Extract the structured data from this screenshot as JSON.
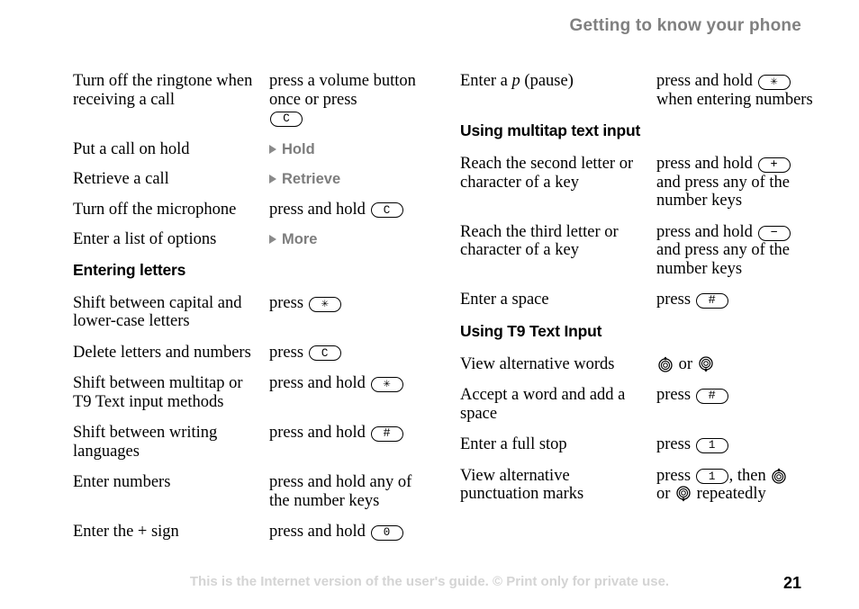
{
  "header": {
    "title": "Getting to know your phone"
  },
  "footer": {
    "note": "This is the Internet version of the user's guide. © Print only for private use.",
    "page_number": "21"
  },
  "keys": {
    "clear": "C",
    "star": "✳",
    "hash": "#",
    "zero": "0",
    "one": "1",
    "plus": "+",
    "minus": "−"
  },
  "left_column": {
    "rows_top": [
      {
        "action": "Turn off the ringtone when receiving a call",
        "method_pre": "press a volume button once or press",
        "key": "C",
        "type": "text-then-key-newline"
      },
      {
        "action": "Put a call on hold",
        "softkey": "Hold",
        "type": "softkey"
      },
      {
        "action": "Retrieve a call",
        "softkey": "Retrieve",
        "type": "softkey"
      },
      {
        "action": "Turn off the microphone",
        "method_pre": "press and hold",
        "key": "C",
        "type": "text-key"
      },
      {
        "action": "Enter a list of options",
        "softkey": "More",
        "type": "softkey"
      }
    ],
    "heading": "Entering letters",
    "rows_bottom": [
      {
        "action": "Shift between capital and lower-case letters",
        "method_pre": "press",
        "key": "✳",
        "type": "text-key"
      },
      {
        "action": "Delete letters and numbers",
        "method_pre": "press",
        "key": "C",
        "type": "text-key"
      },
      {
        "action": "Shift between multitap or T9 Text input methods",
        "method_pre": "press and hold",
        "key": "✳",
        "type": "text-key"
      },
      {
        "action": "Shift between writing languages",
        "method_pre": "press and hold",
        "key": "#",
        "type": "text-key"
      },
      {
        "action": "Enter numbers",
        "method_pre": "press and hold any of the number keys",
        "type": "text-only"
      },
      {
        "action": "Enter the + sign",
        "method_pre": "press and hold",
        "key": "0",
        "type": "text-key"
      }
    ]
  },
  "right_column": {
    "row_pause": {
      "action_pre": "Enter a ",
      "action_italic": "p",
      "action_post": " (pause)",
      "method_pre": "press and hold",
      "key": "✳",
      "method_post": "when entering numbers"
    },
    "heading_multitap": "Using multitap text input",
    "rows_multitap": [
      {
        "action": "Reach the second letter or character of a key",
        "method_pre": "press and hold",
        "key": "+",
        "method_post": "and press any of the number keys"
      },
      {
        "action": "Reach the third letter or character of a key",
        "method_pre": "press and hold",
        "key": "−",
        "method_post": "and press any of the number keys"
      },
      {
        "action": "Enter a space",
        "method_pre": "press",
        "key": "#",
        "method_post": ""
      }
    ],
    "heading_t9": "Using T9 Text Input",
    "rows_t9": [
      {
        "action": "View alternative words",
        "nav_up": "scroll-up-key-icon",
        "joiner": "or",
        "nav_down": "scroll-down-key-icon",
        "type": "navkeys"
      },
      {
        "action": "Accept a word and add a space",
        "method_pre": "press",
        "key": "#",
        "type": "text-key"
      },
      {
        "action": "Enter a full stop",
        "method_pre": "press",
        "key": "1",
        "type": "text-key"
      },
      {
        "action": "View alternative punctuation marks",
        "method_pre": "press",
        "key": "1",
        "method_mid": ", then",
        "method_joiner": "or",
        "method_post": "repeatedly",
        "type": "text-key-navkeys"
      }
    ]
  }
}
